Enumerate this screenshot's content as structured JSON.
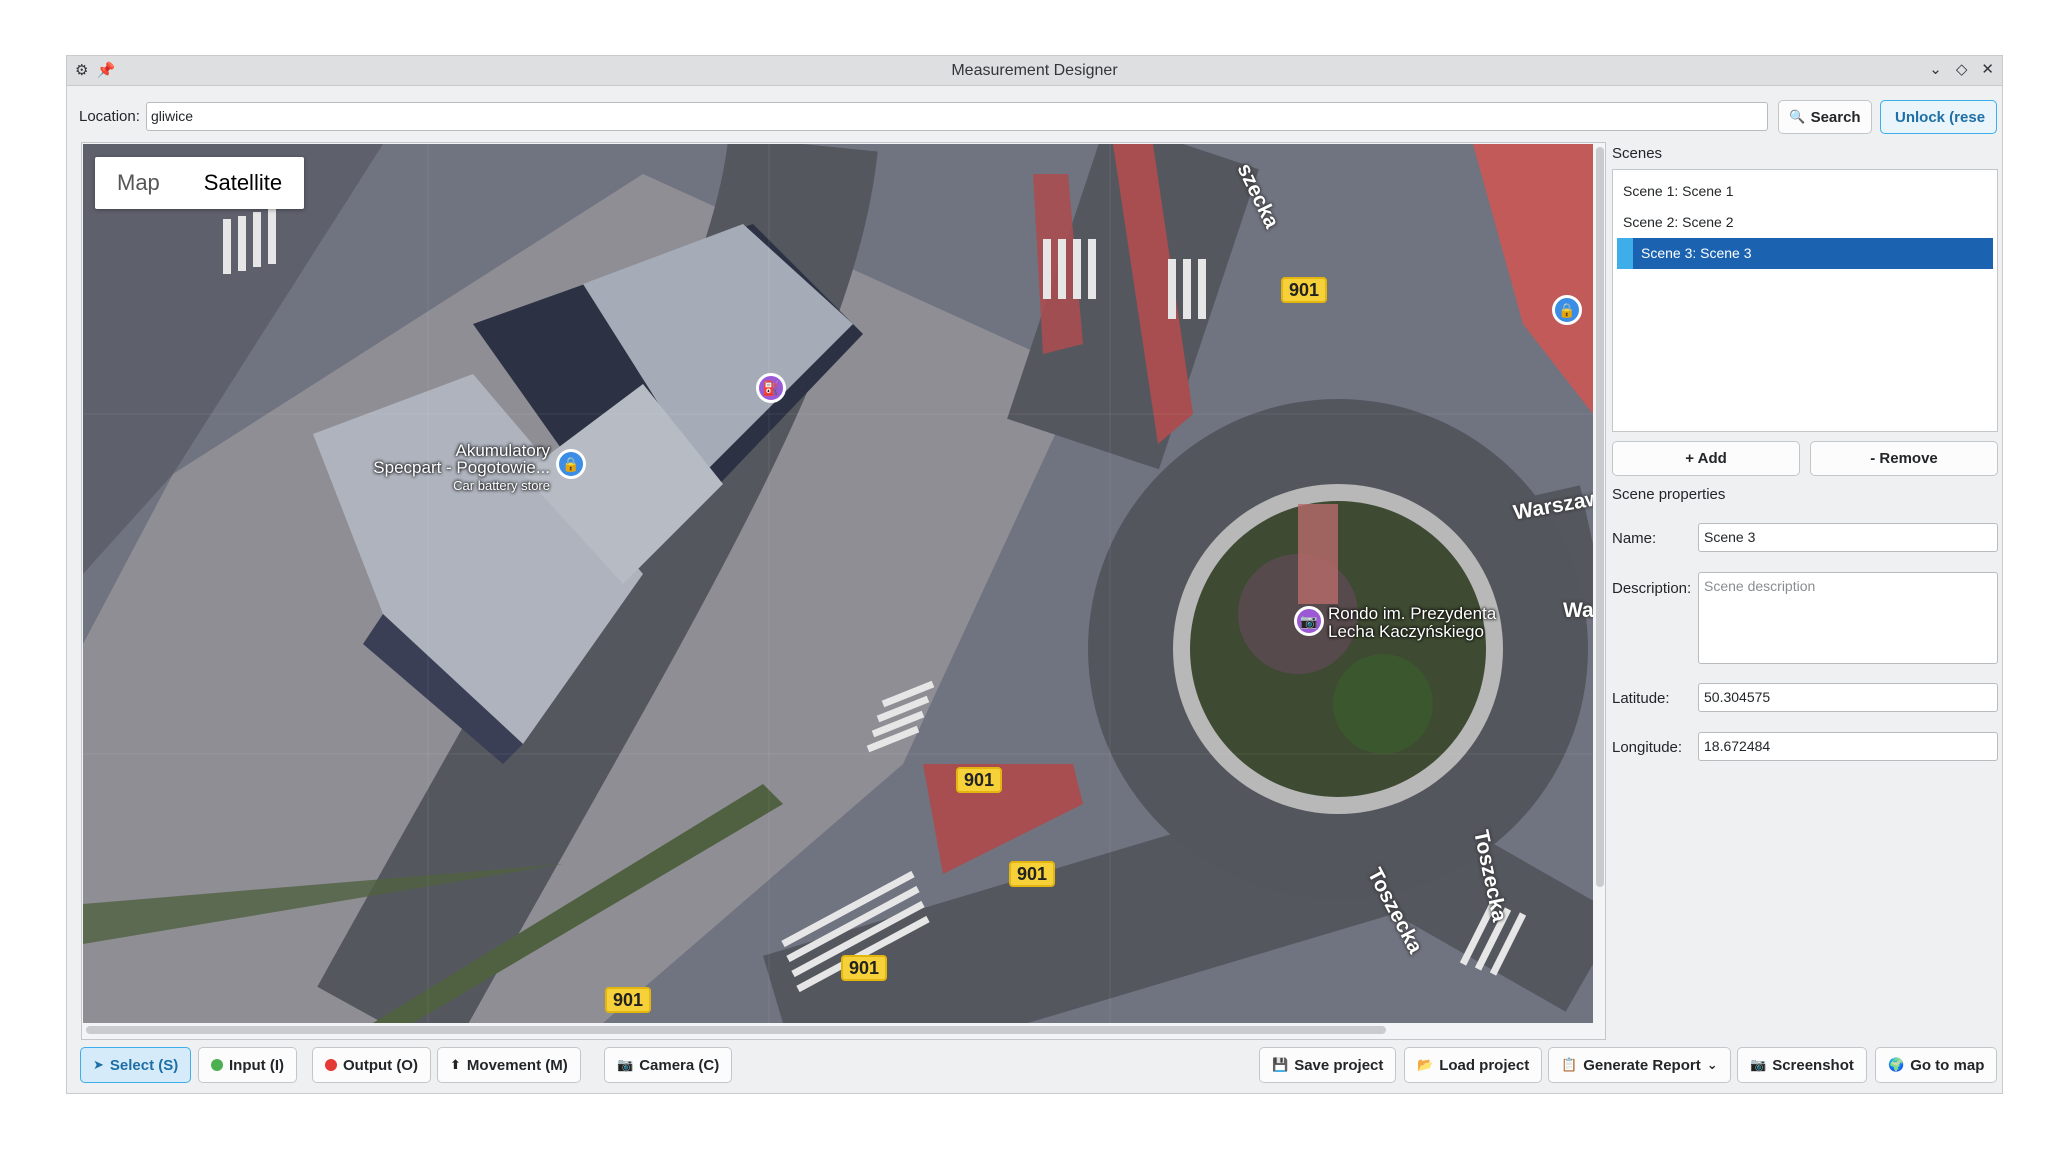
{
  "window": {
    "title": "Measurement Designer"
  },
  "location": {
    "label": "Location:",
    "value": "gliwice"
  },
  "buttons": {
    "search": "Search",
    "unlock": "Unlock (rese"
  },
  "map": {
    "types": [
      "Map",
      "Satellite"
    ],
    "active_type": "Satellite",
    "road_shields": [
      "901",
      "901",
      "901",
      "901",
      "901"
    ],
    "poi": [
      {
        "name": "Akumulatory Specpart - Pogotowie...",
        "line1": "Akumulatory",
        "line2": "Specpart - Pogotowie...",
        "category": "Car battery store"
      },
      {
        "name": "Rondo im. Prezydenta Lecha Kaczyńskiego",
        "line1": "Rondo im. Prezydenta",
        "line2": "Lecha Kaczyńskiego"
      }
    ],
    "streets": [
      "szecka",
      "Warszaw",
      "Wa",
      "Toszecka",
      "Toszecka"
    ]
  },
  "scenes": {
    "title": "Scenes",
    "items": [
      {
        "label": "Scene 1: Scene 1",
        "selected": false
      },
      {
        "label": "Scene 2: Scene 2",
        "selected": false
      },
      {
        "label": "Scene 3: Scene 3",
        "selected": true
      }
    ],
    "add": "+ Add",
    "remove": "- Remove"
  },
  "properties": {
    "title": "Scene properties",
    "name_label": "Name:",
    "name": "Scene 3",
    "description_label": "Description:",
    "description_placeholder": "Scene description",
    "latitude_label": "Latitude:",
    "latitude": "50.304575",
    "longitude_label": "Longitude:",
    "longitude": "18.672484"
  },
  "toolbar": {
    "select": "Select (S)",
    "input": "Input (I)",
    "output": "Output (O)",
    "movement": "Movement (M)",
    "camera": "Camera (C)",
    "save": "Save project",
    "load": "Load project",
    "report": "Generate Report",
    "screenshot": "Screenshot",
    "goto": "Go to map"
  },
  "colors": {
    "accent": "#3daee9",
    "selection": "#1b63b0",
    "shield": "#f7d13a",
    "input_dot": "#4caf50",
    "output_dot": "#e53935"
  },
  "icons": [
    "app-icon",
    "pin-icon",
    "chevron-down-icon",
    "restore-icon",
    "close-icon",
    "search-icon",
    "save-icon",
    "folder-icon",
    "report-icon",
    "camera-icon",
    "globe-icon"
  ]
}
